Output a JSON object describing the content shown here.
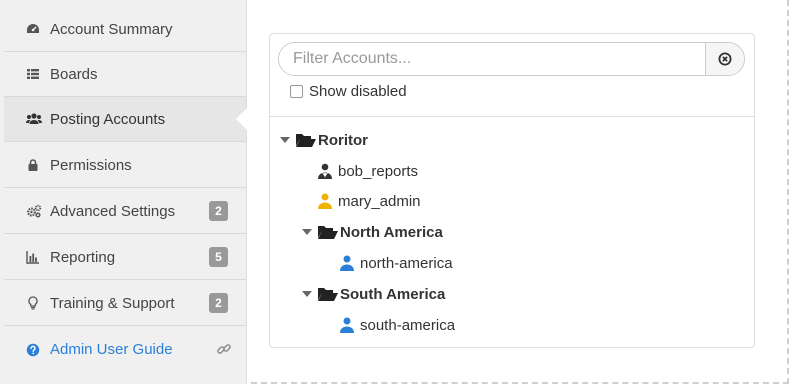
{
  "sidebar": {
    "items": [
      {
        "label": "Account Summary",
        "icon": "dashboard-icon"
      },
      {
        "label": "Boards",
        "icon": "list-icon"
      },
      {
        "label": "Posting Accounts",
        "icon": "users-icon",
        "active": true
      },
      {
        "label": "Permissions",
        "icon": "lock-icon"
      },
      {
        "label": "Advanced Settings",
        "icon": "gears-icon",
        "badge": "2"
      },
      {
        "label": "Reporting",
        "icon": "bar-chart-icon",
        "badge": "5"
      },
      {
        "label": "Training & Support",
        "icon": "lightbulb-icon",
        "badge": "2"
      },
      {
        "label": "Admin User Guide",
        "icon": "question-circle-icon",
        "external": "link-icon"
      }
    ]
  },
  "panel": {
    "filter_placeholder": "Filter Accounts...",
    "filter_value": "",
    "clear_icon": "times-circle-icon",
    "show_disabled_label": "Show disabled",
    "show_disabled_checked": false
  },
  "tree": {
    "root": {
      "label": "Roritor",
      "expanded": true
    },
    "root_users": [
      {
        "label": "bob_reports",
        "icon": "user-tie-icon",
        "color": "#333333"
      },
      {
        "label": "mary_admin",
        "icon": "user-icon",
        "color": "#f0b400"
      }
    ],
    "groups": [
      {
        "label": "North America",
        "expanded": true,
        "user": {
          "label": "north-america",
          "icon": "user-icon",
          "color": "#2b7fd6"
        }
      },
      {
        "label": "South America",
        "expanded": true,
        "user": {
          "label": "south-america",
          "icon": "user-icon",
          "color": "#2b7fd6"
        }
      }
    ]
  },
  "colors": {
    "link": "#2b7fd6",
    "badge": "#999999",
    "admin_user": "#f0b400",
    "group_user": "#2b7fd6"
  }
}
